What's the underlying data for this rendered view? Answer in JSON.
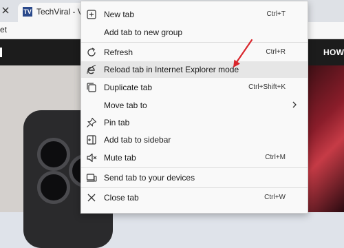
{
  "browser": {
    "tab_title": "TechViral - Viral",
    "favicon_letter": "TV",
    "address_partial": "et"
  },
  "page": {
    "nav_links": [
      "Y",
      "HOW"
    ]
  },
  "context_menu": {
    "items": [
      {
        "label": "New tab",
        "shortcut": "Ctrl+T",
        "icon": "new-tab-icon"
      },
      {
        "label": "Add tab to new group",
        "shortcut": "",
        "icon": ""
      },
      {
        "label": "Refresh",
        "shortcut": "Ctrl+R",
        "icon": "refresh-icon"
      },
      {
        "label": "Reload tab in Internet Explorer mode",
        "shortcut": "",
        "icon": "internet-explorer-icon",
        "highlighted": true
      },
      {
        "label": "Duplicate tab",
        "shortcut": "Ctrl+Shift+K",
        "icon": "duplicate-icon"
      },
      {
        "label": "Move tab to",
        "shortcut": "",
        "icon": "",
        "submenu": true
      },
      {
        "label": "Pin tab",
        "shortcut": "",
        "icon": "pin-icon"
      },
      {
        "label": "Add tab to sidebar",
        "shortcut": "",
        "icon": "sidebar-icon"
      },
      {
        "label": "Mute tab",
        "shortcut": "Ctrl+M",
        "icon": "speaker-icon"
      },
      {
        "label": "Send tab to your devices",
        "shortcut": "",
        "icon": "devices-icon"
      },
      {
        "label": "Close tab",
        "shortcut": "Ctrl+W",
        "icon": "close-icon"
      }
    ]
  },
  "colors": {
    "annotation_arrow": "#d9262c",
    "menu_background": "#f9f9f9",
    "highlight": "#e6e6e6"
  }
}
